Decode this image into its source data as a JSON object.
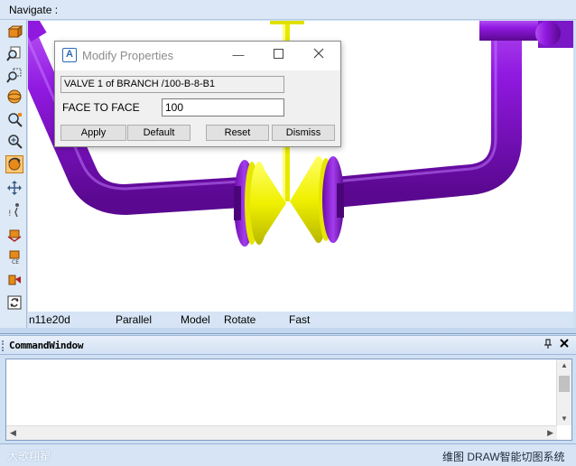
{
  "navigate": {
    "label": "Navigate :"
  },
  "toolbar": {
    "tools": [
      {
        "icon": "orbit-box-icon"
      },
      {
        "icon": "zoom-document-icon"
      },
      {
        "icon": "zoom-box-icon"
      },
      {
        "icon": "zoom-sphere-icon"
      },
      {
        "icon": "zoom-region-icon"
      },
      {
        "icon": "zoom-in-icon"
      },
      {
        "icon": "model-rotate-icon"
      },
      {
        "icon": "pan-arrows-icon"
      },
      {
        "icon": "walk-icon"
      },
      {
        "icon": "fly-icon"
      },
      {
        "icon": "camera-eye-icon"
      },
      {
        "icon": "clip-icon"
      },
      {
        "icon": "refresh-icon"
      }
    ],
    "active_index": 6
  },
  "status_bar": {
    "name": "n11e20d",
    "projection": "Parallel",
    "mode": "Model",
    "action": "Rotate",
    "speed": "Fast"
  },
  "dialog": {
    "title": "Modify Properties",
    "element_info": "VALVE 1 of BRANCH /100-B-8-B1",
    "field_label": "FACE TO FACE",
    "field_value": "100",
    "buttons": {
      "apply": "Apply",
      "default": "Default",
      "reset": "Reset",
      "dismiss": "Dismiss"
    }
  },
  "command_window": {
    "title": "CommandWindow"
  },
  "bottom": {
    "watermark_left": "大歌翔翟",
    "watermark_right": "维图 DRAW智能切图系统"
  },
  "colors": {
    "pipe": "#8a10d8",
    "valve": "#f3f300",
    "stem": "#e8e800",
    "viewport_bg": "#ffffff",
    "chrome": "#d6e4f5"
  }
}
